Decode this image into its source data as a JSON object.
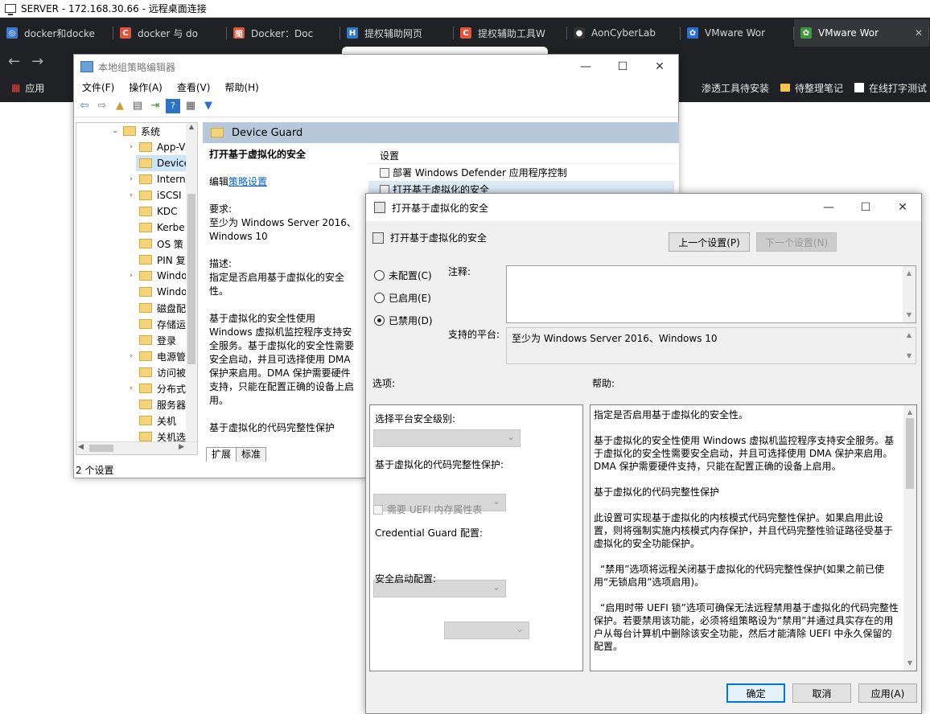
{
  "rdp": {
    "title": "SERVER - 172.168.30.66 - 远程桌面连接"
  },
  "browser": {
    "tabs": [
      {
        "title": "docker和docke",
        "color": "#3b7bd4",
        "glyph": "◎"
      },
      {
        "title": "docker 与 do",
        "color": "#e0543b",
        "glyph": "C"
      },
      {
        "title": "Docker：Doc",
        "color": "#e0543b",
        "glyph": "简"
      },
      {
        "title": "提权辅助网页",
        "color": "#3178c6",
        "glyph": "H"
      },
      {
        "title": "提权辅助工具W",
        "color": "#e0543b",
        "glyph": "C"
      },
      {
        "title": "AonCyberLab",
        "color": "#333333",
        "glyph": "●"
      },
      {
        "title": "VMware Wor",
        "color": "#2a6fd6",
        "glyph": "✿"
      },
      {
        "title": "VMware Wor",
        "color": "#3b9a3b",
        "glyph": "✿"
      }
    ],
    "bookmarks": [
      {
        "label": "应用"
      },
      {
        "label": "渗透工具待安装"
      },
      {
        "label": "待整理笔记"
      },
      {
        "label": "在线打字测试"
      }
    ]
  },
  "gpe": {
    "title": "本地组策略编辑器",
    "menu": [
      "文件(F)",
      "操作(A)",
      "查看(V)",
      "帮助(H)"
    ],
    "tree": [
      {
        "label": "系统",
        "level": 0,
        "expander": "⌄"
      },
      {
        "label": "App-V",
        "level": 1,
        "expander": "›"
      },
      {
        "label": "Device",
        "level": 1,
        "expander": "",
        "selected": true
      },
      {
        "label": "Intern",
        "level": 1,
        "expander": "›"
      },
      {
        "label": "iSCSI",
        "level": 1,
        "expander": "›"
      },
      {
        "label": "KDC",
        "level": 1,
        "expander": ""
      },
      {
        "label": "Kerbe",
        "level": 1,
        "expander": ""
      },
      {
        "label": "OS 策",
        "level": 1,
        "expander": ""
      },
      {
        "label": "PIN 复",
        "level": 1,
        "expander": ""
      },
      {
        "label": "Windo",
        "level": 1,
        "expander": "›"
      },
      {
        "label": "Windo",
        "level": 1,
        "expander": ""
      },
      {
        "label": "磁盘配",
        "level": 1,
        "expander": ""
      },
      {
        "label": "存储运",
        "level": 1,
        "expander": ""
      },
      {
        "label": "登录",
        "level": 1,
        "expander": ""
      },
      {
        "label": "电源管",
        "level": 1,
        "expander": "›"
      },
      {
        "label": "访问被",
        "level": 1,
        "expander": ""
      },
      {
        "label": "分布式",
        "level": 1,
        "expander": "›"
      },
      {
        "label": "服务器",
        "level": 1,
        "expander": ""
      },
      {
        "label": "关机",
        "level": 1,
        "expander": ""
      },
      {
        "label": "关机选",
        "level": 1,
        "expander": ""
      }
    ],
    "folder_header": "Device Guard",
    "desc": {
      "title": "打开基于虚拟化的安全",
      "edit_prefix": "编辑",
      "edit_link": "策略设置",
      "req_label": "要求:",
      "req_text": "至少为 Windows Server 2016、Windows 10",
      "desc_label": "描述:",
      "desc_text": "指定是否启用基于虚拟化的安全性。",
      "body1": "基于虚拟化的安全性使用 Windows 虚拟机监控程序支持安全服务。基于虚拟化的安全性需要安全启动，并且可选择使用 DMA 保护来启用。DMA 保护需要硬件支持，只能在配置正确的设备上启用。",
      "body2": "基于虚拟化的代码完整性保护"
    },
    "settings_header": "设置",
    "settings": [
      {
        "label": "部署 Windows Defender 应用程序控制",
        "selected": false
      },
      {
        "label": "打开基于虚拟化的安全",
        "selected": true
      }
    ],
    "bottom_tabs": [
      "扩展",
      "标准"
    ],
    "status": "2 个设置"
  },
  "dialog": {
    "title": "打开基于虚拟化的安全",
    "setting_name": "打开基于虚拟化的安全",
    "prev_button": "上一个设置(P)",
    "next_button": "下一个设置(N)",
    "radio": [
      {
        "label": "未配置(C)",
        "checked": false
      },
      {
        "label": "已启用(E)",
        "checked": false
      },
      {
        "label": "已禁用(D)",
        "checked": true
      }
    ],
    "comment_label": "注释:",
    "platform_label": "支持的平台:",
    "platform_value": "至少为 Windows Server 2016、Windows 10",
    "options_label": "选项:",
    "help_label": "帮助:",
    "options": {
      "platform_level": "选择平台安全级别:",
      "code_integrity": "基于虚拟化的代码完整性保护:",
      "uefi_mem": "需要 UEFI 内存属性表",
      "credential_guard": "Credential Guard 配置:",
      "secure_boot": "安全启动配置:"
    },
    "help": [
      "指定是否启用基于虚拟化的安全性。",
      "基于虚拟化的安全性使用 Windows 虚拟机监控程序支持安全服务。基于虚拟化的安全性需要安全启动，并且可选择使用 DMA 保护来启用。DMA 保护需要硬件支持，只能在配置正确的设备上启用。",
      "基于虚拟化的代码完整性保护",
      "此设置可实现基于虚拟化的内核模式代码完整性保护。如果启用此设置，则将强制实施内核模式内存保护，并且代码完整性验证路径受基于虚拟化的安全功能保护。",
      "“禁用”选项将远程关闭基于虚拟化的代码完整性保护(如果之前已使用“无锁启用”选项启用)。",
      "“启用时带 UEFI 锁”选项可确保无法远程禁用基于虚拟化的代码完整性保护。若要禁用该功能，必须将组策略设为“禁用”并通过具实存在的用户从每台计算机中删除该安全功能，然后才能清除 UEFI 中永久保留的配置。"
    ],
    "ok_button": "确定",
    "cancel_button": "取消",
    "apply_button": "应用(A)"
  }
}
